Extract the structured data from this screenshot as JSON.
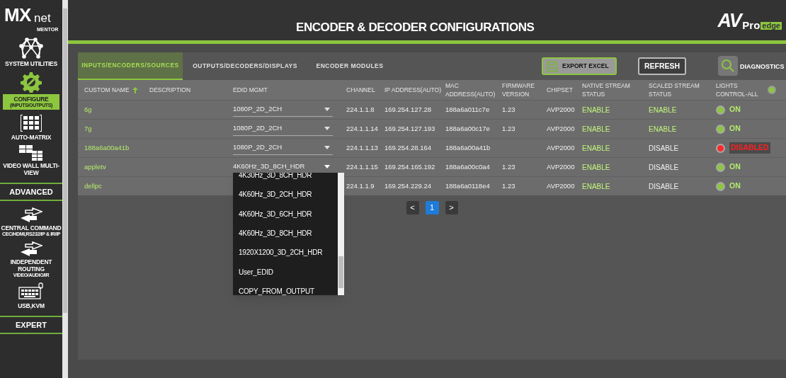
{
  "logo": {
    "main": "MX",
    "suffix": "net",
    "sub": "MENTOR"
  },
  "header": {
    "title": "ENCODER & DECODER CONFIGURATIONS",
    "brand": {
      "main": "AV",
      "mid": "Pro",
      "tag": "edge"
    }
  },
  "sidebar": {
    "items": [
      {
        "kind": "nav",
        "label": "SYSTEM UTILITIES",
        "selected": false
      },
      {
        "kind": "nav",
        "label": "CONFIGURE",
        "sublabel": "(INPUTS/OUTPUTS)",
        "selected": true
      },
      {
        "kind": "nav",
        "label": "AUTO-MATRIX",
        "selected": false
      },
      {
        "kind": "nav",
        "label": "VIDEO WALL MULTI-VIEW",
        "selected": false
      },
      {
        "kind": "section",
        "label": "ADVANCED"
      },
      {
        "kind": "nav",
        "label": "CENTRAL COMMAND",
        "sublabel": "CEC/HDMI,RS232/IP & IR/IP",
        "selected": false
      },
      {
        "kind": "nav",
        "label": "INDEPENDENT ROUTING",
        "sublabel": "VIDEO/AUDIO/IR",
        "selected": false
      },
      {
        "kind": "nav",
        "label": "USB,KVM",
        "selected": false
      },
      {
        "kind": "section",
        "label": "EXPERT"
      }
    ]
  },
  "tabs": [
    {
      "label": "INPUTS/ENCODERS/SOURCES",
      "selected": true
    },
    {
      "label": "OUTPUTS/DECODERS/DISPLAYS",
      "selected": false
    },
    {
      "label": "ENCODER MODULES",
      "selected": false
    }
  ],
  "toolbar": {
    "export": "EXPORT EXCEL",
    "refresh": "REFRESH",
    "diagnostics": "DIAGNOSTICS"
  },
  "table": {
    "columns": [
      "CUSTOM NAME",
      "DESCRIPTION",
      "EDID MGMT",
      "CHANNEL",
      "IP ADDRESS(AUTO)",
      "MAC ADDRESS(AUTO)",
      "FIRMWARE VERSION",
      "CHIPSET",
      "NATIVE STREAM STATUS",
      "SCALED STREAM STATUS",
      "LIGHTS CONTROL-ALL"
    ],
    "lights_all_on": true,
    "rows": [
      {
        "name": "6g",
        "edid": "1080P_2D_2CH",
        "expanded": false,
        "channel": "224.1.1.8",
        "ip": "169.254.127.28",
        "mac": "188a6a011c7e",
        "firmware": "1.23",
        "chipset": "AVP2000",
        "native": "ENABLE",
        "native_enabled": true,
        "scaled": "ENABLE",
        "scaled_enabled": true,
        "light": "ON",
        "light_on": true
      },
      {
        "name": "7g",
        "edid": "1080P_2D_2CH",
        "expanded": false,
        "channel": "224.1.1.14",
        "ip": "169.254.127.193",
        "mac": "188a6a00c17e",
        "firmware": "1.23",
        "chipset": "AVP2000",
        "native": "ENABLE",
        "native_enabled": true,
        "scaled": "ENABLE",
        "scaled_enabled": true,
        "light": "ON",
        "light_on": true
      },
      {
        "name": "188a6a00a41b",
        "edid": "1080P_2D_2CH",
        "expanded": false,
        "channel": "224.1.1.13",
        "ip": "169.254.28.164",
        "mac": "188a6a00a41b",
        "chipset": "AVP2000",
        "native": "ENABLE",
        "native_enabled": true,
        "scaled": "DISABLE",
        "scaled_enabled": false,
        "light": "DISABLED",
        "light_on": false
      },
      {
        "name": "appletv",
        "edid": "4K60Hz_3D_8CH_HDR",
        "expanded": true,
        "channel": "224.1.1.15",
        "ip": "169.254.165.192",
        "mac": "188a6a00c0a4",
        "firmware": "1.23",
        "chipset": "AVP2000",
        "native": "ENABLE",
        "native_enabled": true,
        "scaled": "DISABLE",
        "scaled_enabled": false,
        "light": "ON",
        "light_on": true
      },
      {
        "name": "dellpc",
        "channel": "224.1.1.9",
        "ip": "169.254.229.24",
        "mac": "188a6a0118e4",
        "firmware": "1.23",
        "chipset": "AVP2000",
        "native": "ENABLE",
        "native_enabled": true,
        "scaled": "DISABLE",
        "scaled_enabled": false,
        "light": "ON",
        "light_on": true
      }
    ]
  },
  "dropdown": {
    "options": [
      "4K30Hz_3D_8CH_HDR",
      "4K60Hz_3D_2CH_HDR",
      "4K60Hz_3D_6CH_HDR",
      "4K60Hz_3D_8CH_HDR",
      "1920X1200_3D_2CH_HDR",
      "User_EDID",
      "COPY_FROM_OUTPUT"
    ]
  },
  "pagination": {
    "prev": "<",
    "pages": [
      {
        "label": "1",
        "selected": true
      }
    ],
    "next": ">"
  }
}
